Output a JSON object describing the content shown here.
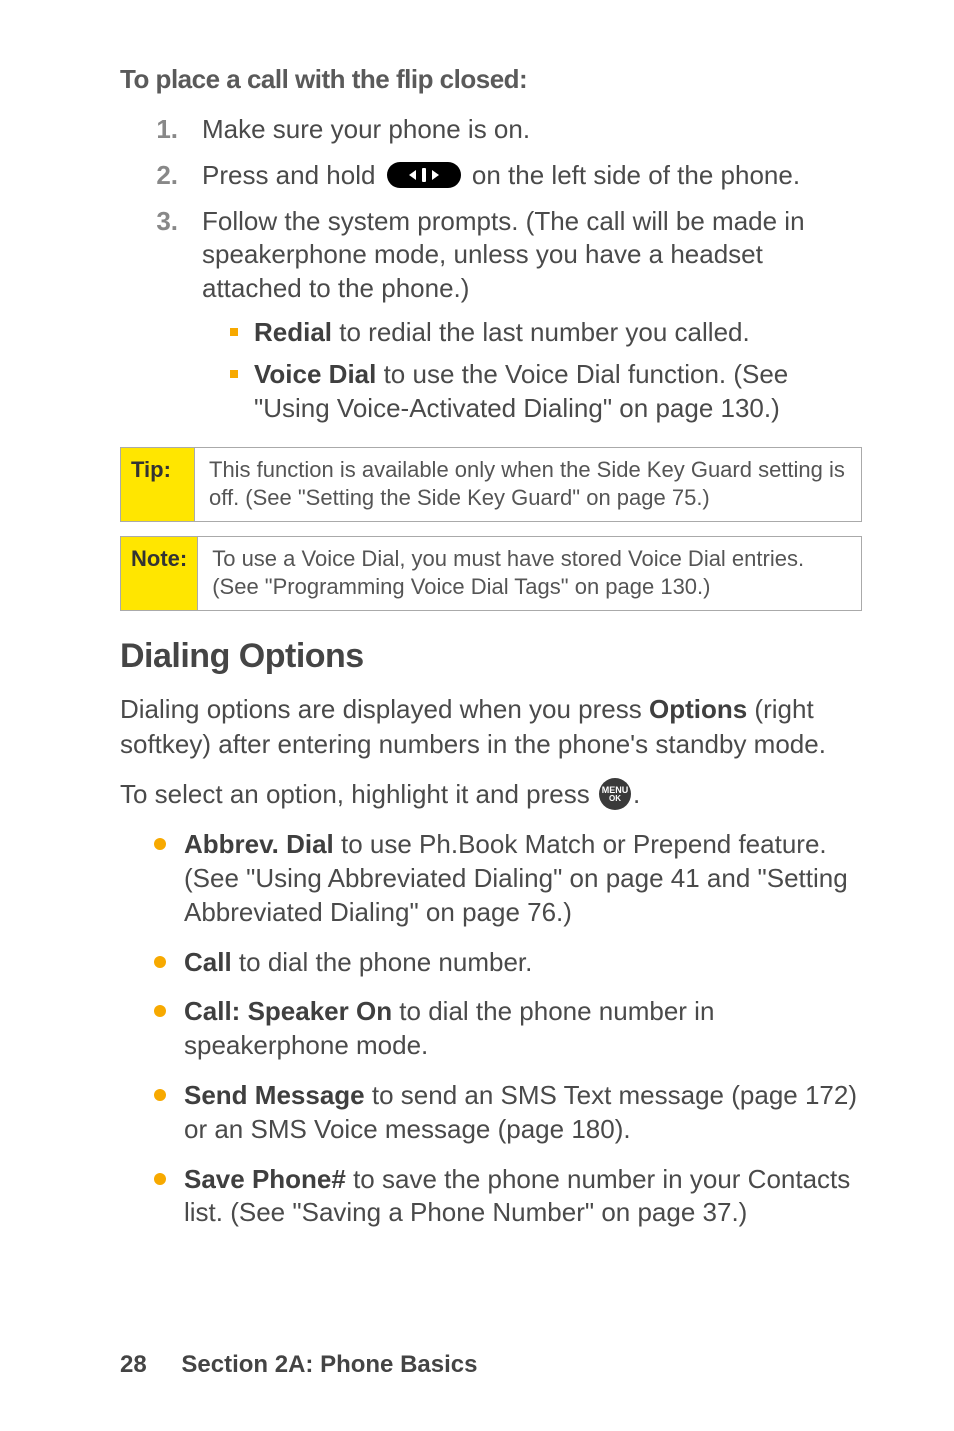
{
  "heading_sub": "To place a call with the flip closed:",
  "steps": [
    {
      "num": "1.",
      "text": "Make sure your phone is on."
    },
    {
      "num": "2.",
      "pre": "Press and hold ",
      "post": " on the left side of the phone."
    },
    {
      "num": "3.",
      "text": "Follow the system prompts. (The call will be made in speakerphone mode, unless you have a headset attached to the phone.)"
    }
  ],
  "sub_items": [
    {
      "bold": "Redial",
      "rest": " to redial the last number you called."
    },
    {
      "bold": "Voice Dial",
      "rest": " to use the Voice Dial function. (See \"Using Voice-Activated Dialing\" on page 130.)"
    }
  ],
  "tip": {
    "label": "Tip:",
    "body": "This function is available only when the Side Key Guard setting is off. (See \"Setting the Side Key Guard\" on page 75.)"
  },
  "note": {
    "label": "Note:",
    "body": "To use a Voice Dial, you must have stored Voice Dial entries. (See \"Programming Voice Dial Tags\" on page 130.)"
  },
  "section_title": "Dialing Options",
  "para1_pre": "Dialing options are displayed when you press ",
  "para1_bold": "Options",
  "para1_post": " (right softkey) after entering numbers in the phone's standby mode.",
  "para2_pre": "To select an option, highlight it and press ",
  "para2_post": ".",
  "menu_icon": {
    "line1": "MENU",
    "line2": "OK"
  },
  "options": [
    {
      "bold": "Abbrev. Dial",
      "rest": " to use Ph.Book Match or Prepend feature. (See \"Using Abbreviated Dialing\" on page 41 and \"Setting Abbreviated Dialing\" on page 76.)"
    },
    {
      "bold": "Call",
      "rest": " to dial the phone number."
    },
    {
      "bold": "Call: Speaker On",
      "rest": " to dial the phone number in speakerphone mode."
    },
    {
      "bold": "Send Message",
      "rest": " to send an SMS Text message (page 172) or an SMS Voice message (page 180)."
    },
    {
      "bold": "Save Phone#",
      "rest": " to save the phone number in your Contacts list. (See \"Saving a Phone Number\" on page 37.)"
    }
  ],
  "footer": {
    "page": "28",
    "section": "Section 2A: Phone Basics"
  }
}
